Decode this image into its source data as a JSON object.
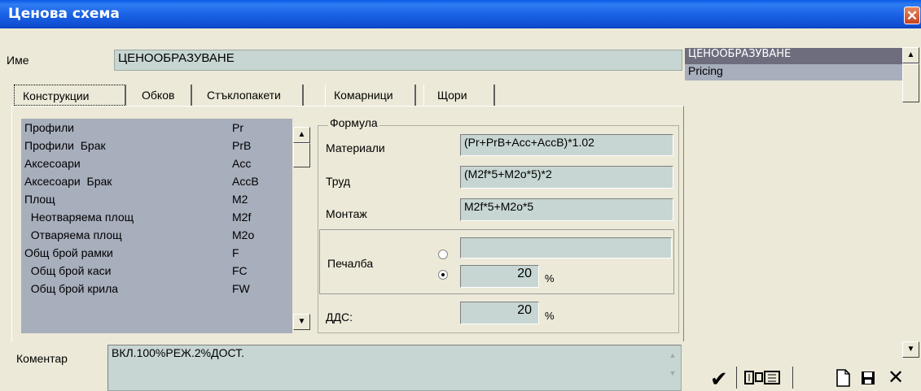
{
  "window": {
    "title": "Ценова схема",
    "close_glyph": "✕"
  },
  "name_row": {
    "label": "Име",
    "value": "ЦЕНООБРАЗУВАНЕ"
  },
  "tabs": [
    {
      "label": "Конструкции",
      "active": true
    },
    {
      "label": "Обков"
    },
    {
      "label": "Стъклопакети"
    },
    {
      "label": "Комарници"
    },
    {
      "label": "Щори"
    }
  ],
  "variables": [
    {
      "name": "Профили",
      "code": "Pr"
    },
    {
      "name": "Профили  Брак",
      "code": "PrB"
    },
    {
      "name": "Аксесоари",
      "code": "Acc"
    },
    {
      "name": "Аксесоари  Брак",
      "code": "AccB"
    },
    {
      "name": "Площ",
      "code": "M2"
    },
    {
      "name": "  Неотваряема площ",
      "code": "M2f"
    },
    {
      "name": "  Отваряема площ",
      "code": "M2o"
    },
    {
      "name": "Общ брой рамки",
      "code": "F"
    },
    {
      "name": "  Общ брой каси",
      "code": "FC"
    },
    {
      "name": "  Общ брой крила",
      "code": "FW"
    }
  ],
  "formula": {
    "group_title": "Формула",
    "materials": {
      "label": "Материали",
      "value": "(Pr+PrB+Acc+AccB)*1.02"
    },
    "labor": {
      "label": "Труд",
      "value": "(M2f*5+M2o*5)*2"
    },
    "installation": {
      "label": "Монтаж",
      "value": "M2f*5+M2o*5"
    },
    "profit": {
      "label": "Печалба",
      "value_amount": "",
      "value_percent": "20",
      "unit": "%",
      "selected_option": "percent"
    },
    "vat": {
      "label": "ДДС:",
      "value": "20",
      "unit": "%"
    }
  },
  "comment": {
    "label": "Коментар",
    "value": "ВКЛ.100%РЕЖ.2%ДОСТ."
  },
  "schemes": {
    "items": [
      "ЦЕНООБРАЗУВАНЕ",
      "Pricing"
    ],
    "selected_index": 0
  },
  "toolbar": {
    "confirm_icon": "✔",
    "columns_icon": "columns",
    "new_icon": "new-document",
    "save_icon": "save",
    "delete_icon": "✕"
  },
  "colors": {
    "field_bg": "#c7d6d2",
    "list_bg": "#a7aebc",
    "title_bar": "#0f4fd2",
    "selected_item": "#7a7a8c"
  }
}
